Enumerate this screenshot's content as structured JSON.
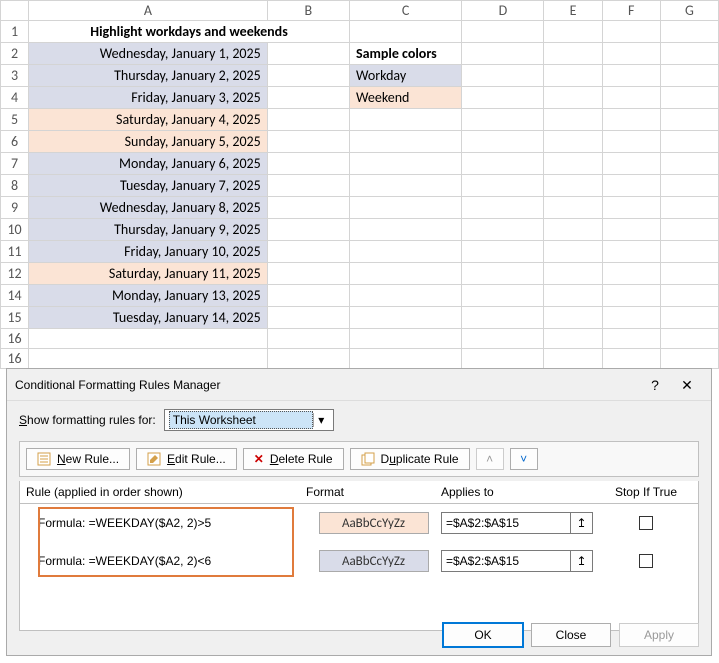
{
  "columns": [
    "A",
    "B",
    "C",
    "D",
    "E",
    "F",
    "G"
  ],
  "title": "Highlight workdays and weekends",
  "sample_header": "Sample colors",
  "sample_workday": "Workday",
  "sample_weekend": "Weekend",
  "dates": [
    {
      "text": "Wednesday, January 1, 2025",
      "cls": "workday-bg"
    },
    {
      "text": "Thursday, January 2, 2025",
      "cls": "workday-bg"
    },
    {
      "text": "Friday, January 3, 2025",
      "cls": "workday-bg"
    },
    {
      "text": "Saturday, January 4, 2025",
      "cls": "weekend-bg"
    },
    {
      "text": "Sunday, January 5, 2025",
      "cls": "weekend-bg"
    },
    {
      "text": "Monday, January 6, 2025",
      "cls": "workday-bg"
    },
    {
      "text": "Tuesday, January 7, 2025",
      "cls": "workday-bg"
    },
    {
      "text": "Wednesday, January 8, 2025",
      "cls": "workday-bg"
    },
    {
      "text": "Thursday, January 9, 2025",
      "cls": "workday-bg"
    },
    {
      "text": "Friday, January 10, 2025",
      "cls": "workday-bg"
    },
    {
      "text": "Saturday, January 11, 2025",
      "cls": "weekend-bg"
    },
    {
      "text": "Monday, January 13, 2025",
      "cls": "workday-bg"
    },
    {
      "text": "Tuesday, January 14, 2025",
      "cls": "workday-bg"
    }
  ],
  "dialog": {
    "title": "Conditional Formatting Rules Manager",
    "show_rules_label": "Show formatting rules for:",
    "show_rules_value": "This Worksheet",
    "btn_new": "New Rule...",
    "btn_edit": "Edit Rule...",
    "btn_delete": "Delete Rule",
    "btn_duplicate": "Duplicate Rule",
    "hdr_rule": "Rule (applied in order shown)",
    "hdr_format": "Format",
    "hdr_applies": "Applies to",
    "hdr_stop": "Stop If True",
    "format_sample": "AaBbCcYyZz",
    "rules": [
      {
        "formula": "Formula: =WEEKDAY($A2, 2)>5",
        "applies": "=$A$2:$A$15",
        "fmt": "fp-weekend"
      },
      {
        "formula": "Formula: =WEEKDAY($A2, 2)<6",
        "applies": "=$A$2:$A$15",
        "fmt": "fp-workday"
      }
    ],
    "btn_ok": "OK",
    "btn_close": "Close",
    "btn_apply": "Apply"
  }
}
